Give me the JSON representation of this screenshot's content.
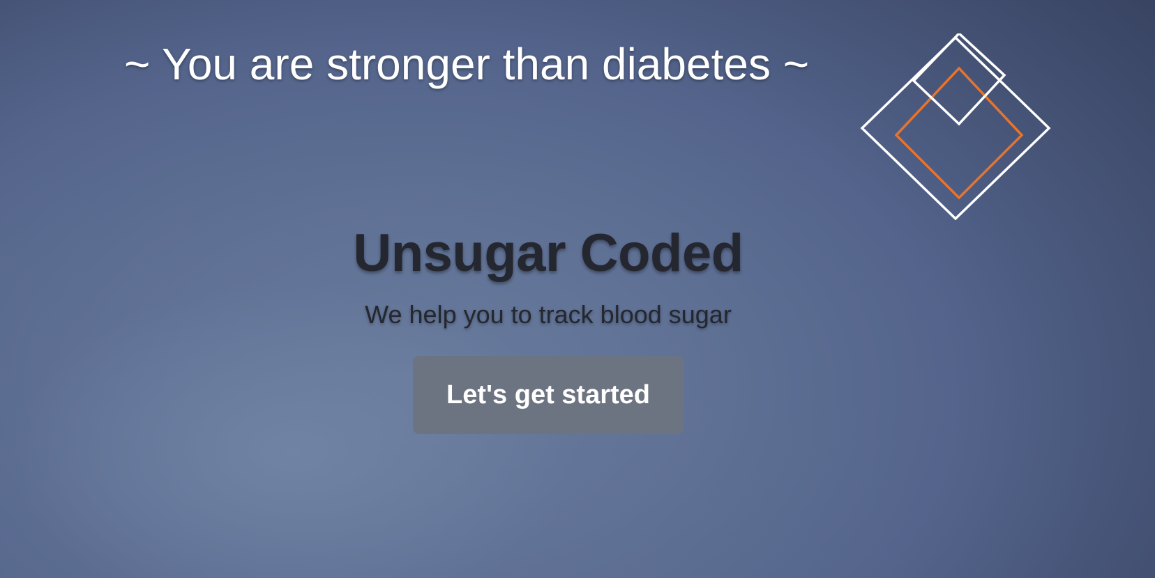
{
  "tagline": "~ You are stronger than diabetes ~",
  "hero": {
    "title": "Unsugar Coded",
    "subtitle": "We help you to track blood sugar",
    "cta_label": "Let's get started"
  },
  "logo": {
    "icon": "diamond-logo-icon",
    "stroke_color": "#ffffff",
    "accent_color": "#e8742c"
  },
  "colors": {
    "button_background": "#6d7481",
    "title_color": "#24272f"
  }
}
